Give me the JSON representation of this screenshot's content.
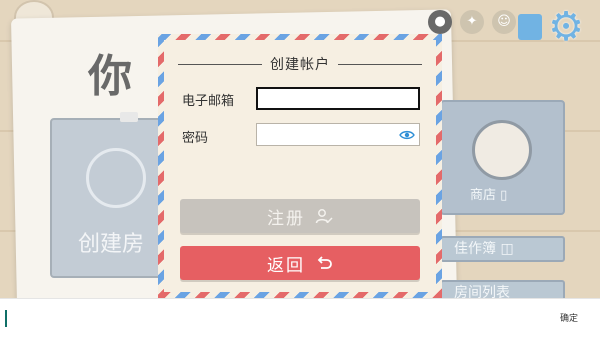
{
  "background": {
    "big_title": "你",
    "card_left_label": "创建房",
    "shop_label": "商店",
    "portfolio_label": "佳作簿",
    "rooms_label": "房间列表"
  },
  "dialog": {
    "title": "创建帐户",
    "email_label": "电子邮箱",
    "email_value": "",
    "password_label": "密码",
    "password_value": "",
    "register_label": "注册",
    "back_label": "返回"
  },
  "bottom_bar": {
    "input_value": "",
    "confirm_label": "确定"
  },
  "colors": {
    "accent_red": "#e65f62",
    "accent_blue": "#2f8fd6",
    "disabled_gray": "#c7c3bd"
  },
  "icons": {
    "settings": "gear-icon",
    "map": "map-icon",
    "password_toggle": "eye-icon",
    "register": "user-check-icon",
    "back": "undo-arrow-icon",
    "shop": "shopping-bag-icon"
  }
}
